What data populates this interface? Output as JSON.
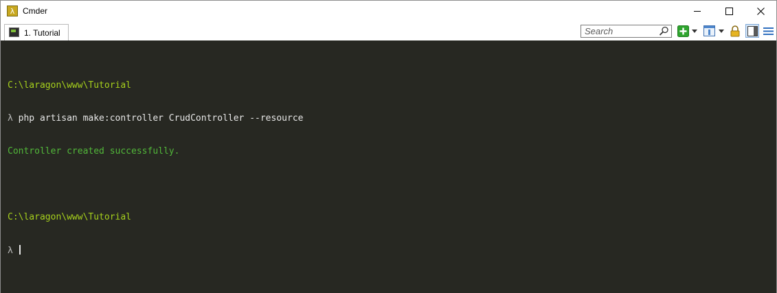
{
  "window": {
    "title": "Cmder",
    "app_icon_glyph": "λ",
    "controls": {
      "minimize": "minimize-icon",
      "maximize": "maximize-icon",
      "close": "close-icon"
    }
  },
  "tabbar": {
    "tabs": [
      {
        "label": "1. Tutorial",
        "icon": "console-icon",
        "active": true
      }
    ]
  },
  "toolbar": {
    "search_placeholder": "Search",
    "buttons": [
      "search-icon",
      "add-console-icon",
      "dropdown-icon",
      "panel-icon",
      "dropdown-icon",
      "lock-icon",
      "split-view-icon",
      "menu-icon"
    ]
  },
  "terminal": {
    "prompt_path_1": "C:\\laragon\\www\\Tutorial",
    "prompt_symbol": "λ",
    "command": "php artisan make:controller CrudController --resource",
    "output": "Controller created successfully.",
    "prompt_path_2": "C:\\laragon\\www\\Tutorial"
  },
  "colors": {
    "console_bg": "#272822",
    "path": "#a6d01c",
    "success": "#52b83a",
    "text": "#e8e8e8"
  }
}
